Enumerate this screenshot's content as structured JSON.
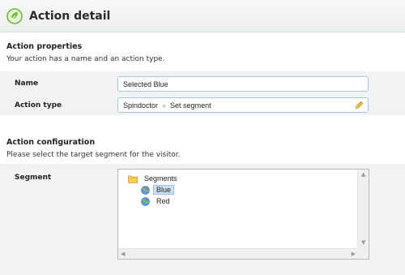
{
  "header": {
    "title": "Action detail",
    "icon": "action-leaf-icon"
  },
  "properties": {
    "title": "Action properties",
    "description": "Your action has a name and an action type.",
    "name_label": "Name",
    "name_value": "Selected Blue",
    "type_label": "Action type",
    "type_part1": "Spindoctor",
    "type_separator": "»",
    "type_part2": "Set segment"
  },
  "configuration": {
    "title": "Action configuration",
    "description": "Please select the target segment for the visitor.",
    "segment_label": "Segment",
    "tree": {
      "root": "Segments",
      "children": [
        {
          "label": "Blue",
          "selected": true
        },
        {
          "label": "Red",
          "selected": false
        }
      ]
    }
  },
  "colors": {
    "accent": "#6cbf2b",
    "row_bg": "#f1f3f3",
    "input_border": "#a9c7dc",
    "selection": "#cde0f5"
  }
}
